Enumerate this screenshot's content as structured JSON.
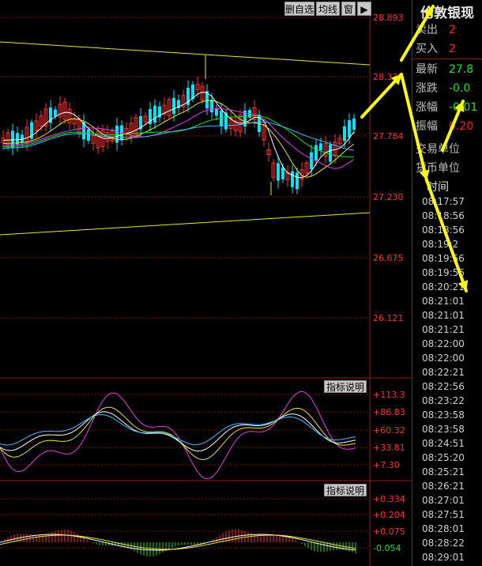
{
  "toolbar": {
    "remove_fav": "删自选",
    "ma": "均线",
    "window": "窗",
    "pin": "▶"
  },
  "price_axis": [
    "28.893",
    "28.338",
    "27.784",
    "27.230",
    "26.675",
    "26.121"
  ],
  "indicator1": {
    "label": "指标说明",
    "axis": [
      "+113.3",
      "+86.83",
      "+60.32",
      "+33.81",
      "+7.30"
    ]
  },
  "indicator2": {
    "label": "指标说明",
    "axis": [
      "+0.334",
      "+0.204",
      "+0.075",
      "-0.054"
    ]
  },
  "panel": {
    "title": "伦敦银现",
    "quotes": [
      {
        "label": "卖出",
        "value": "2",
        "color": "#ff2020"
      },
      {
        "label": "买入",
        "value": "2",
        "color": "#ff2020"
      },
      {
        "label": "最新",
        "value": "27.8",
        "color": "#20e020"
      },
      {
        "label": "涨跌",
        "value": "-0.0",
        "color": "#20e020"
      },
      {
        "label": "涨幅",
        "value": "-0.01",
        "color": "#20e020"
      },
      {
        "label": "振幅",
        "value": "0.20",
        "color": "#ff2020"
      }
    ],
    "trade_unit": "交易单位",
    "currency_unit": "货币单位",
    "time_header": "时间",
    "times": [
      "08:17:57",
      "08:18:56",
      "08:18:56",
      "08:19:2",
      "08:19:56",
      "08:19:56",
      "08:20:21",
      "08:21:01",
      "08:21:01",
      "08:21:21",
      "08:22:00",
      "08:22:00",
      "08:22:21",
      "08:22:56",
      "08:23:22",
      "08:23:58",
      "08:23:58",
      "08:24:51",
      "08:25:20",
      "08:25:21",
      "08:26:21",
      "08:27:01",
      "08:27:51",
      "08:28:01",
      "08:28:22",
      "08:29:01"
    ]
  },
  "colors": {
    "up": "#ff3030",
    "down": "#00e5ff",
    "trendline": "#e8e830",
    "grid": "#8b1a1a",
    "annotation_arrow": "#ffff00"
  }
}
